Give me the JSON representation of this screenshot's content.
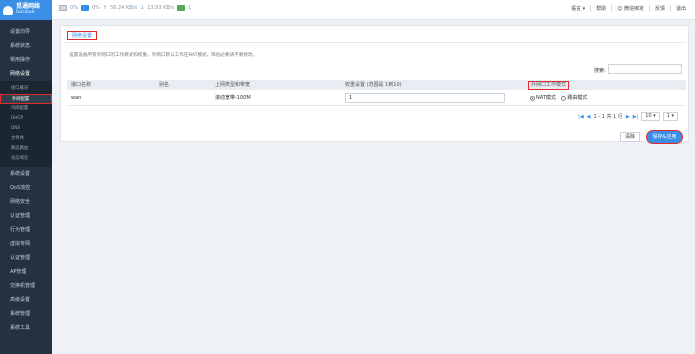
{
  "brand": {
    "name_cn": "觅通网络",
    "name_en": "Gocloud"
  },
  "status": {
    "iface1": "0%",
    "iface2": "0%",
    "upload": "56.24 KB/s",
    "download": "13.93 KB/s",
    "monitor": "1"
  },
  "header": {
    "items": [
      "语言",
      "帮助",
      "微信绑定",
      "反馈",
      "退出"
    ]
  },
  "sidebar": {
    "items_top": [
      "设置向导",
      "系统状态",
      "常用操作",
      "网络设置"
    ],
    "sub_items": [
      "接口概况",
      "外网配置",
      "内网配置",
      "DHCP",
      "DNS",
      "文件共",
      "静态路由",
      "动态域名"
    ],
    "items_bottom": [
      "系统设置",
      "QoS流控",
      "网络安全",
      "认证管理",
      "行为管理",
      "虚拟专网",
      "认证管理",
      "AP管理",
      "交换机管理",
      "高级设置",
      "系统管理",
      "系统工具"
    ]
  },
  "tab": {
    "label": "网络设置"
  },
  "description": "设置设备所有外网口的工作模式和权重。外网口默认工作在NAT模式，降低必要请不要修改。",
  "search": {
    "label": "搜索:",
    "value": ""
  },
  "table": {
    "headers": [
      "接口名称",
      "别名",
      "上网类型和带宽",
      "权重设置 (范围是 1到10)",
      "外网口工作模式"
    ],
    "rows": [
      {
        "name": "wan",
        "alias": "",
        "type": "滚动宽带-100M",
        "weight": "1",
        "mode_nat": "NAT模式",
        "mode_route": "路由模式"
      }
    ]
  },
  "pager": {
    "info": "1 - 1 共 1 行",
    "page_size": "10",
    "page": "1"
  },
  "buttons": {
    "clear": "清除",
    "save": "保存&应用"
  },
  "colors": {
    "accent": "#3a8ee6",
    "highlight": "#e32b2b",
    "sidebar_bg": "#233140"
  }
}
